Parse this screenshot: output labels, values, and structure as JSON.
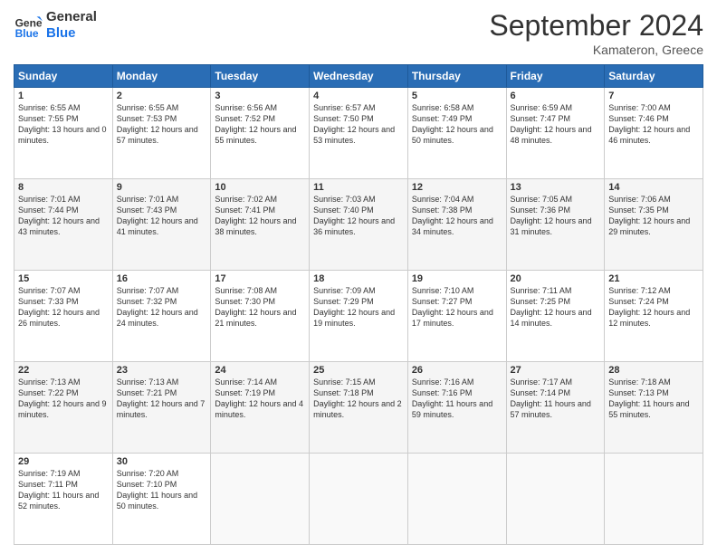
{
  "logo": {
    "line1": "General",
    "line2": "Blue"
  },
  "title": "September 2024",
  "subtitle": "Kamateron, Greece",
  "header_days": [
    "Sunday",
    "Monday",
    "Tuesday",
    "Wednesday",
    "Thursday",
    "Friday",
    "Saturday"
  ],
  "weeks": [
    [
      {
        "day": "1",
        "sunrise": "Sunrise: 6:55 AM",
        "sunset": "Sunset: 7:55 PM",
        "daylight": "Daylight: 13 hours and 0 minutes."
      },
      {
        "day": "2",
        "sunrise": "Sunrise: 6:55 AM",
        "sunset": "Sunset: 7:53 PM",
        "daylight": "Daylight: 12 hours and 57 minutes."
      },
      {
        "day": "3",
        "sunrise": "Sunrise: 6:56 AM",
        "sunset": "Sunset: 7:52 PM",
        "daylight": "Daylight: 12 hours and 55 minutes."
      },
      {
        "day": "4",
        "sunrise": "Sunrise: 6:57 AM",
        "sunset": "Sunset: 7:50 PM",
        "daylight": "Daylight: 12 hours and 53 minutes."
      },
      {
        "day": "5",
        "sunrise": "Sunrise: 6:58 AM",
        "sunset": "Sunset: 7:49 PM",
        "daylight": "Daylight: 12 hours and 50 minutes."
      },
      {
        "day": "6",
        "sunrise": "Sunrise: 6:59 AM",
        "sunset": "Sunset: 7:47 PM",
        "daylight": "Daylight: 12 hours and 48 minutes."
      },
      {
        "day": "7",
        "sunrise": "Sunrise: 7:00 AM",
        "sunset": "Sunset: 7:46 PM",
        "daylight": "Daylight: 12 hours and 46 minutes."
      }
    ],
    [
      {
        "day": "8",
        "sunrise": "Sunrise: 7:01 AM",
        "sunset": "Sunset: 7:44 PM",
        "daylight": "Daylight: 12 hours and 43 minutes."
      },
      {
        "day": "9",
        "sunrise": "Sunrise: 7:01 AM",
        "sunset": "Sunset: 7:43 PM",
        "daylight": "Daylight: 12 hours and 41 minutes."
      },
      {
        "day": "10",
        "sunrise": "Sunrise: 7:02 AM",
        "sunset": "Sunset: 7:41 PM",
        "daylight": "Daylight: 12 hours and 38 minutes."
      },
      {
        "day": "11",
        "sunrise": "Sunrise: 7:03 AM",
        "sunset": "Sunset: 7:40 PM",
        "daylight": "Daylight: 12 hours and 36 minutes."
      },
      {
        "day": "12",
        "sunrise": "Sunrise: 7:04 AM",
        "sunset": "Sunset: 7:38 PM",
        "daylight": "Daylight: 12 hours and 34 minutes."
      },
      {
        "day": "13",
        "sunrise": "Sunrise: 7:05 AM",
        "sunset": "Sunset: 7:36 PM",
        "daylight": "Daylight: 12 hours and 31 minutes."
      },
      {
        "day": "14",
        "sunrise": "Sunrise: 7:06 AM",
        "sunset": "Sunset: 7:35 PM",
        "daylight": "Daylight: 12 hours and 29 minutes."
      }
    ],
    [
      {
        "day": "15",
        "sunrise": "Sunrise: 7:07 AM",
        "sunset": "Sunset: 7:33 PM",
        "daylight": "Daylight: 12 hours and 26 minutes."
      },
      {
        "day": "16",
        "sunrise": "Sunrise: 7:07 AM",
        "sunset": "Sunset: 7:32 PM",
        "daylight": "Daylight: 12 hours and 24 minutes."
      },
      {
        "day": "17",
        "sunrise": "Sunrise: 7:08 AM",
        "sunset": "Sunset: 7:30 PM",
        "daylight": "Daylight: 12 hours and 21 minutes."
      },
      {
        "day": "18",
        "sunrise": "Sunrise: 7:09 AM",
        "sunset": "Sunset: 7:29 PM",
        "daylight": "Daylight: 12 hours and 19 minutes."
      },
      {
        "day": "19",
        "sunrise": "Sunrise: 7:10 AM",
        "sunset": "Sunset: 7:27 PM",
        "daylight": "Daylight: 12 hours and 17 minutes."
      },
      {
        "day": "20",
        "sunrise": "Sunrise: 7:11 AM",
        "sunset": "Sunset: 7:25 PM",
        "daylight": "Daylight: 12 hours and 14 minutes."
      },
      {
        "day": "21",
        "sunrise": "Sunrise: 7:12 AM",
        "sunset": "Sunset: 7:24 PM",
        "daylight": "Daylight: 12 hours and 12 minutes."
      }
    ],
    [
      {
        "day": "22",
        "sunrise": "Sunrise: 7:13 AM",
        "sunset": "Sunset: 7:22 PM",
        "daylight": "Daylight: 12 hours and 9 minutes."
      },
      {
        "day": "23",
        "sunrise": "Sunrise: 7:13 AM",
        "sunset": "Sunset: 7:21 PM",
        "daylight": "Daylight: 12 hours and 7 minutes."
      },
      {
        "day": "24",
        "sunrise": "Sunrise: 7:14 AM",
        "sunset": "Sunset: 7:19 PM",
        "daylight": "Daylight: 12 hours and 4 minutes."
      },
      {
        "day": "25",
        "sunrise": "Sunrise: 7:15 AM",
        "sunset": "Sunset: 7:18 PM",
        "daylight": "Daylight: 12 hours and 2 minutes."
      },
      {
        "day": "26",
        "sunrise": "Sunrise: 7:16 AM",
        "sunset": "Sunset: 7:16 PM",
        "daylight": "Daylight: 11 hours and 59 minutes."
      },
      {
        "day": "27",
        "sunrise": "Sunrise: 7:17 AM",
        "sunset": "Sunset: 7:14 PM",
        "daylight": "Daylight: 11 hours and 57 minutes."
      },
      {
        "day": "28",
        "sunrise": "Sunrise: 7:18 AM",
        "sunset": "Sunset: 7:13 PM",
        "daylight": "Daylight: 11 hours and 55 minutes."
      }
    ],
    [
      {
        "day": "29",
        "sunrise": "Sunrise: 7:19 AM",
        "sunset": "Sunset: 7:11 PM",
        "daylight": "Daylight: 11 hours and 52 minutes."
      },
      {
        "day": "30",
        "sunrise": "Sunrise: 7:20 AM",
        "sunset": "Sunset: 7:10 PM",
        "daylight": "Daylight: 11 hours and 50 minutes."
      },
      null,
      null,
      null,
      null,
      null
    ]
  ]
}
